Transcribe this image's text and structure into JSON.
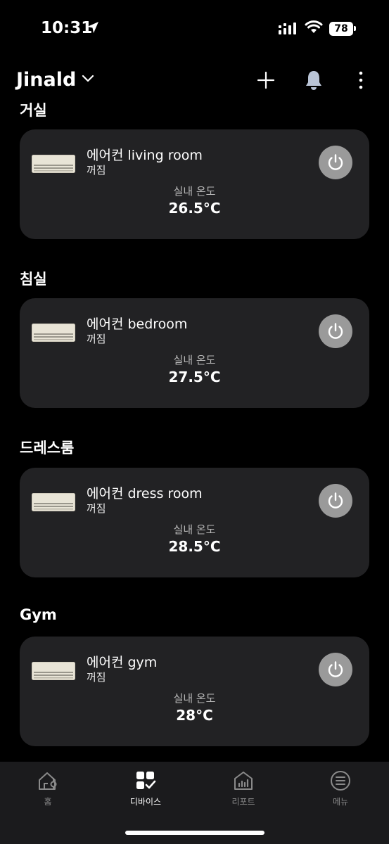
{
  "status_bar": {
    "time": "10:31",
    "battery": "78"
  },
  "header": {
    "home_name": "Jinald"
  },
  "rooms": [
    {
      "title": "거실",
      "device": {
        "name": "에어컨 living room",
        "status": "꺼짐",
        "temp_label": "실내 온도",
        "temp": "26.5°C"
      }
    },
    {
      "title": "침실",
      "device": {
        "name": "에어컨 bedroom",
        "status": "꺼짐",
        "temp_label": "실내 온도",
        "temp": "27.5°C"
      }
    },
    {
      "title": "드레스룸",
      "device": {
        "name": "에어컨 dress room",
        "status": "꺼짐",
        "temp_label": "실내 온도",
        "temp": "28.5°C"
      }
    },
    {
      "title": "Gym",
      "device": {
        "name": "에어컨 gym",
        "status": "꺼짐",
        "temp_label": "실내 온도",
        "temp": "28°C"
      }
    }
  ],
  "bottom_nav": [
    {
      "label": "홈",
      "icon": "home-icon",
      "active": false
    },
    {
      "label": "디바이스",
      "icon": "devices-icon",
      "active": true
    },
    {
      "label": "리포트",
      "icon": "report-icon",
      "active": false
    },
    {
      "label": "메뉴",
      "icon": "menu-icon",
      "active": false
    }
  ],
  "colors": {
    "background": "#000000",
    "card": "#222224",
    "power_button": "#9a9a9a",
    "nav_bar": "#1b1b1d",
    "inactive_nav": "#8a8a8a"
  }
}
